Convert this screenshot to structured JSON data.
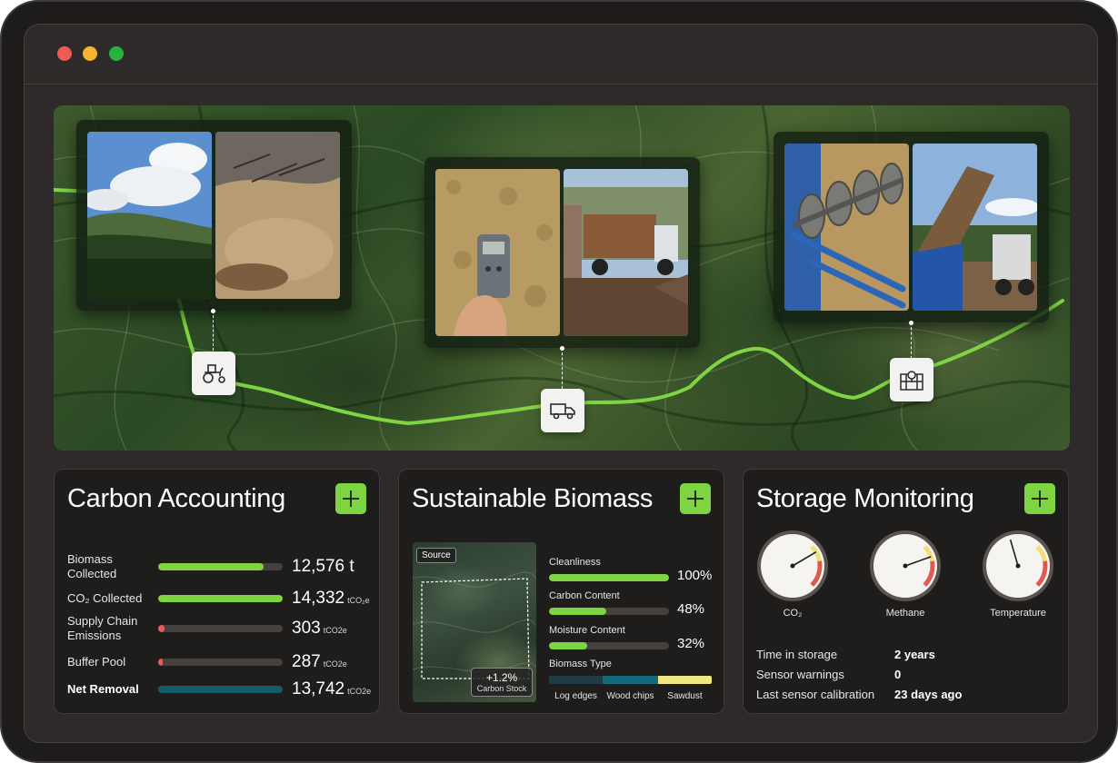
{
  "window": {
    "traffic_lights": [
      {
        "name": "close",
        "color": "#ee5b55"
      },
      {
        "name": "minimize",
        "color": "#f5b530"
      },
      {
        "name": "maximize",
        "color": "#27b23f"
      }
    ]
  },
  "supply_chain_map": {
    "route_color": "#7ed443",
    "stops": [
      {
        "icon": "tractor-icon",
        "photos": [
          "mountain-forest-photo",
          "harvested-ground-photo"
        ]
      },
      {
        "icon": "truck-icon",
        "photos": [
          "moisture-meter-wood-chips-photo",
          "dump-truck-photo"
        ]
      },
      {
        "icon": "storage-facility-icon",
        "photos": [
          "auger-conveyor-photo",
          "tipper-truck-unloading-photo"
        ]
      }
    ]
  },
  "carbon_accounting": {
    "title": "Carbon Accounting",
    "rows": [
      {
        "label": "Biomass Collected",
        "value": "12,576",
        "unit_main": " t",
        "unit": "",
        "fill": 0.85,
        "color": "#7ed443"
      },
      {
        "label": "CO₂ Collected",
        "value": "14,332",
        "unit_main": "",
        "unit": "tCO₂e",
        "fill": 1.0,
        "color": "#7ed443"
      },
      {
        "label": "Supply Chain Emissions",
        "value": "303",
        "unit_main": "",
        "unit": "tCO2e",
        "fill": 0.05,
        "color": "#e85c5c"
      },
      {
        "label": "Buffer Pool",
        "value": "287",
        "unit_main": "",
        "unit": "tCO2e",
        "fill": 0.04,
        "color": "#e85c5c"
      },
      {
        "label": "Net Removal",
        "value": "13,742",
        "unit_main": "",
        "unit": "tCO2e",
        "fill": 1.0,
        "color": "#135d6a"
      }
    ]
  },
  "sustainable_biomass": {
    "title": "Sustainable Biomass",
    "source_tag": "Source",
    "carbon_stock": {
      "value": "+1.2%",
      "label": "Carbon Stock"
    },
    "metrics": [
      {
        "label": "Cleanliness",
        "value": "100%",
        "fill": 1.0
      },
      {
        "label": "Carbon Content",
        "value": "48%",
        "fill": 0.48
      },
      {
        "label": "Moisture Content",
        "value": "32%",
        "fill": 0.32
      }
    ],
    "biomass_type": {
      "label": "Biomass Type",
      "segments": [
        {
          "name": "Log edges",
          "share": 0.33,
          "color": "#1d3c44"
        },
        {
          "name": "Wood chips",
          "share": 0.34,
          "color": "#146a7a"
        },
        {
          "name": "Sawdust",
          "share": 0.33,
          "color": "#f1e680"
        }
      ]
    }
  },
  "storage_monitoring": {
    "title": "Storage Monitoring",
    "gauges": [
      {
        "label": "CO₂",
        "level": 0.72
      },
      {
        "label": "Methane",
        "level": 0.76
      },
      {
        "label": "Temperature",
        "level": 0.44
      }
    ],
    "info": [
      {
        "label": "Time in storage",
        "value": "2 years"
      },
      {
        "label": "Sensor warnings",
        "value": "0"
      },
      {
        "label": "Last sensor calibration",
        "value": "23 days ago"
      }
    ]
  }
}
